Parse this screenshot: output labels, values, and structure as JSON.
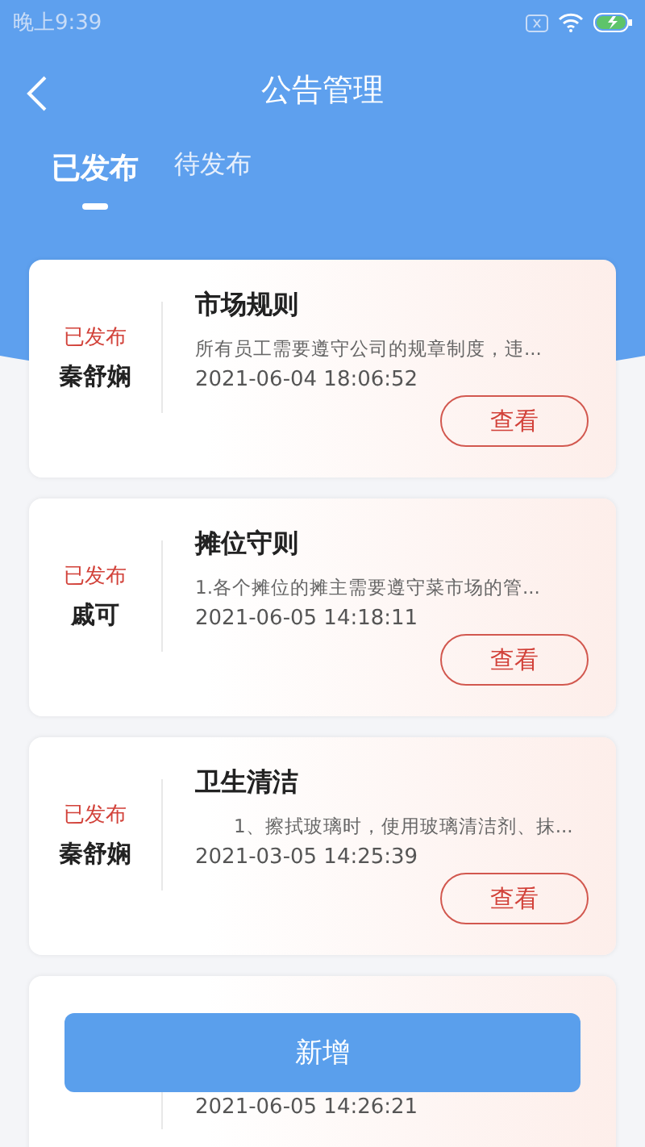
{
  "status_bar": {
    "time": "晚上9:39"
  },
  "header": {
    "title": "公告管理"
  },
  "tabs": [
    {
      "label": "已发布",
      "selected": true
    },
    {
      "label": "待发布",
      "selected": false
    }
  ],
  "notices": [
    {
      "kind": "full",
      "status": "已发布",
      "author": "秦舒娴",
      "title": "市场规则",
      "summary": "所有员工需要遵守公司的规章制度，违...",
      "time": "2021-06-04 18:06:52",
      "action": "查看"
    },
    {
      "kind": "full",
      "status": "已发布",
      "author": "戚可",
      "title": "摊位守则",
      "summary": "1.各个摊位的摊主需要遵守菜市场的管...",
      "time": "2021-06-05 14:18:11",
      "action": "查看"
    },
    {
      "kind": "full",
      "status": "已发布",
      "author": "秦舒娴",
      "title": "卫生清洁",
      "summary": "　　1、擦拭玻璃时，使用玻璃清洁剂、抹...",
      "time": "2021-03-05 14:25:39",
      "action": "查看"
    },
    {
      "kind": "partial",
      "time": "2021-06-05 14:26:21"
    }
  ],
  "add_button": {
    "label": "新增"
  }
}
